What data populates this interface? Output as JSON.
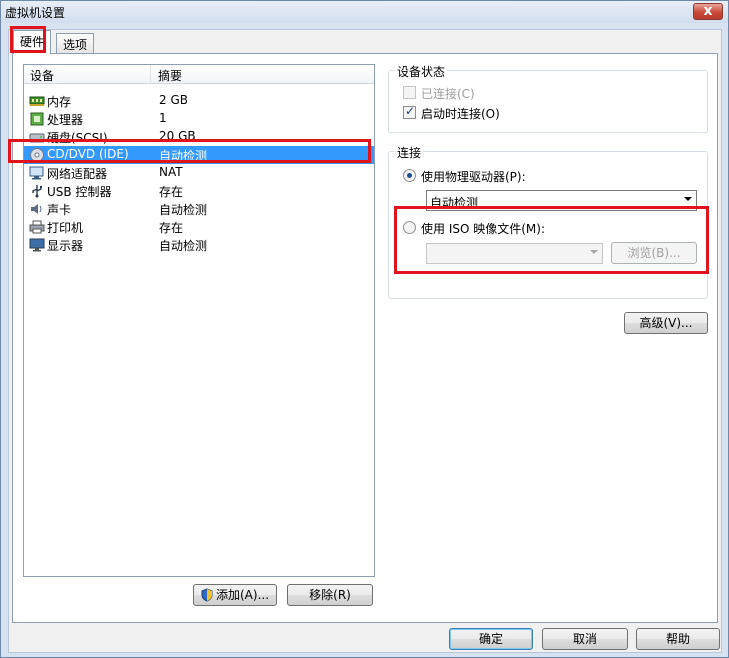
{
  "window": {
    "title": "虚拟机设置",
    "close_glyph": "x"
  },
  "tabs": [
    {
      "label": "硬件"
    },
    {
      "label": "选项"
    }
  ],
  "device_list": {
    "headers": {
      "device": "设备",
      "summary": "摘要"
    },
    "rows": [
      {
        "name": "内存",
        "summary": "2 GB",
        "icon": "memory-icon"
      },
      {
        "name": "处理器",
        "summary": "1",
        "icon": "processor-icon"
      },
      {
        "name": "硬盘(SCSI)",
        "summary": "20 GB",
        "icon": "hard-disk-icon"
      },
      {
        "name": "CD/DVD (IDE)",
        "summary": "自动检测",
        "icon": "cd-dvd-icon",
        "selected": true
      },
      {
        "name": "网络适配器",
        "summary": "NAT",
        "icon": "network-adapter-icon"
      },
      {
        "name": "USB 控制器",
        "summary": "存在",
        "icon": "usb-icon"
      },
      {
        "name": "声卡",
        "summary": "自动检测",
        "icon": "sound-card-icon"
      },
      {
        "name": "打印机",
        "summary": "存在",
        "icon": "printer-icon"
      },
      {
        "name": "显示器",
        "summary": "自动检测",
        "icon": "display-icon"
      }
    ],
    "add_label": "添加(A)...",
    "remove_label": "移除(R)"
  },
  "device_status": {
    "title": "设备状态",
    "connected": {
      "label": "已连接(C)",
      "checked": false,
      "enabled": false
    },
    "connect_at_power_on": {
      "label": "启动时连接(O)",
      "checked": true
    }
  },
  "connection": {
    "title": "连接",
    "physical_drive": {
      "label": "使用物理驱动器(P):",
      "selected": true,
      "value": "自动检测"
    },
    "iso_image": {
      "label": "使用 ISO 映像文件(M):",
      "selected": false,
      "value": "",
      "browse_label": "浏览(B)..."
    }
  },
  "advanced_label": "高级(V)...",
  "dialog_buttons": {
    "ok": "确定",
    "cancel": "取消",
    "help": "帮助"
  },
  "colors": {
    "selection": "#3399ff",
    "highlight_box": "#e0141c"
  }
}
